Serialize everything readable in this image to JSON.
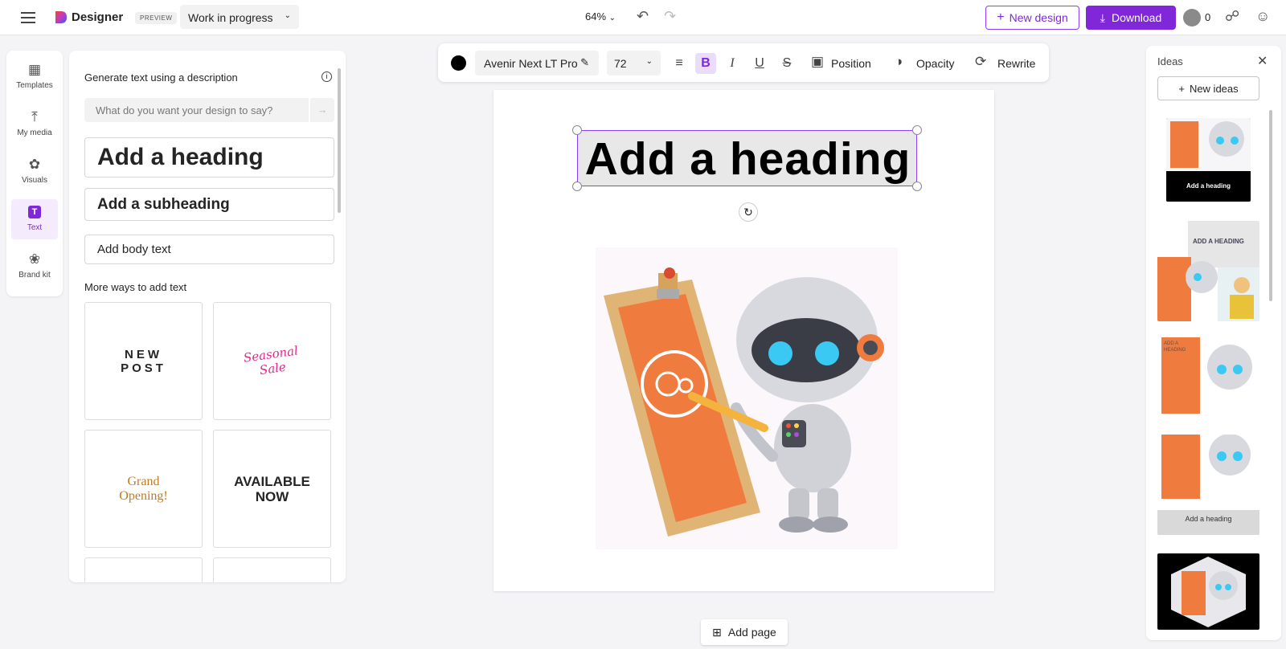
{
  "topbar": {
    "brand": "Designer",
    "preview_badge": "PREVIEW",
    "doc_status": "Work in progress",
    "zoom": "64%",
    "new_design": "New design",
    "download": "Download",
    "credits": "0"
  },
  "rail": {
    "items": [
      {
        "label": "Templates",
        "icon": "templates-icon"
      },
      {
        "label": "My media",
        "icon": "upload-icon"
      },
      {
        "label": "Visuals",
        "icon": "shapes-icon"
      },
      {
        "label": "Text",
        "icon": "text-icon"
      },
      {
        "label": "Brand kit",
        "icon": "palette-icon"
      }
    ]
  },
  "text_panel": {
    "title": "Generate text using a description",
    "input_placeholder": "What do you want your design to say?",
    "heading": "Add a heading",
    "subheading": "Add a subheading",
    "body": "Add body text",
    "more_title": "More ways to add text",
    "cards": {
      "new_post_line1": "NEW",
      "new_post_line2": "POST",
      "seasonal_line1": "Seasonal",
      "seasonal_line2": "Sale",
      "grand_line1": "Grand",
      "grand_line2": "Opening!",
      "available_line1": "AVAILABLE",
      "available_line2": "NOW"
    }
  },
  "format_toolbar": {
    "font": "Avenir Next LT Pro",
    "size": "72",
    "position": "Position",
    "opacity": "Opacity",
    "rewrite": "Rewrite"
  },
  "canvas": {
    "heading": "Add a heading"
  },
  "add_page": "Add page",
  "ideas": {
    "title": "Ideas",
    "new_ideas": "New ideas",
    "thumb1_text": "Add a heading",
    "thumb2_text": "ADD A HEADING",
    "thumb3_text": "ADD A HEADING",
    "thumb4_text": "Add a heading"
  },
  "colors": {
    "accent": "#7f27d9",
    "robot_orange": "#f07b3f",
    "robot_eye": "#39c9f2"
  }
}
